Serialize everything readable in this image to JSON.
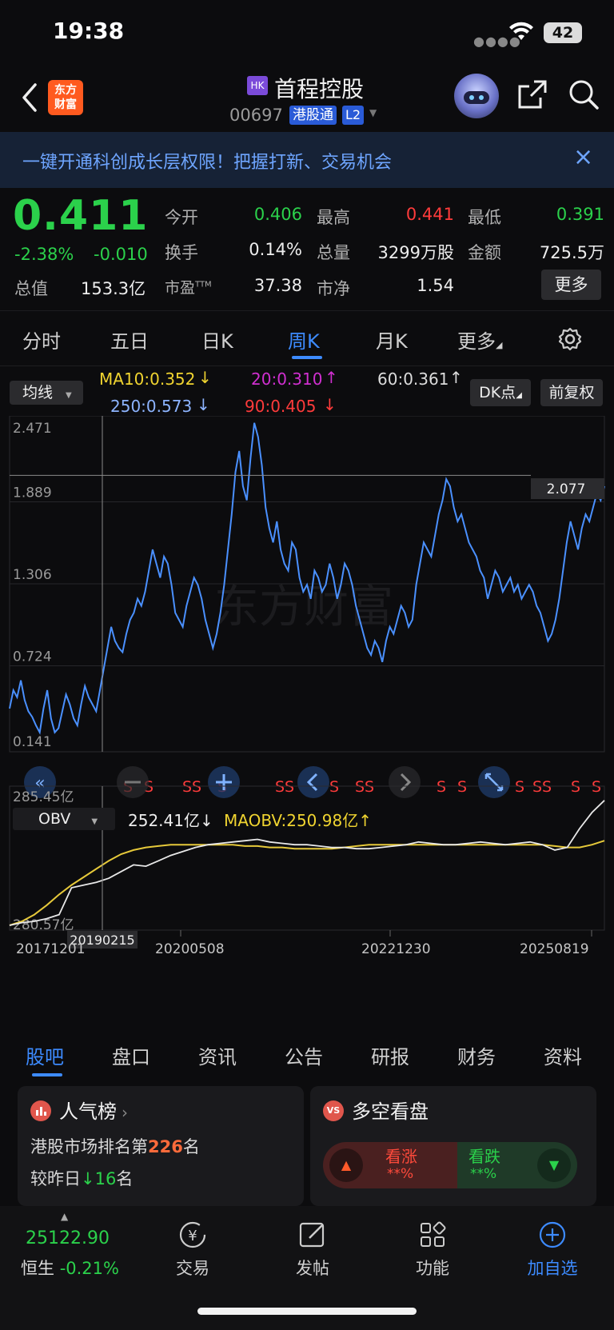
{
  "status_bar": {
    "time": "19:38",
    "battery": "42"
  },
  "header": {
    "app_logo_line1": "东方",
    "app_logo_line2": "财富",
    "market_badge": "HK",
    "stock_name": "首程控股",
    "stock_code": "00697",
    "connect_badge": "港股通",
    "level_badge": "L2"
  },
  "banner": {
    "text": "一键开通科创成长层权限！把握打新、交易机会"
  },
  "quote": {
    "price": "0.411",
    "change_pct": "-2.38%",
    "change_abs": "-0.010",
    "market_cap_label": "总值",
    "market_cap": "153.3亿",
    "fields": {
      "open_label": "今开",
      "open": "0.406",
      "high_label": "最高",
      "high": "0.441",
      "low_label": "最低",
      "low": "0.391",
      "turnover_label": "换手",
      "turnover": "0.14%",
      "volume_label": "总量",
      "volume": "3299万股",
      "amount_label": "金额",
      "amount": "725.5万",
      "pe_label": "市盈",
      "pe_sup": "TTM",
      "pe": "37.38",
      "pb_label": "市净",
      "pb": "1.54"
    },
    "more_label": "更多"
  },
  "period_tabs": [
    "分时",
    "五日",
    "日K",
    "周K",
    "月K",
    "更多"
  ],
  "ma_row": {
    "select_label": "均线",
    "ma10": "MA10:0.352",
    "ma20": "20:0.310",
    "ma60": "60:0.361",
    "ma250": "250:0.573",
    "ma90": "90:0.405",
    "dk_label": "DK点",
    "adjust_label": "前复权"
  },
  "chart_data": {
    "type": "line",
    "y_ticks": [
      "2.471",
      "1.889",
      "1.306",
      "0.724",
      "0.141"
    ],
    "ylim": [
      0.141,
      2.471
    ],
    "crosshair_price": "2.077",
    "watermark": "东方财富",
    "signal_labels": [
      "S",
      "S",
      "SS",
      "S",
      "SS",
      "S",
      "SS",
      "S",
      "S",
      "S",
      "SS",
      "S",
      "S"
    ],
    "x_labels": [
      "20171201",
      "20200508",
      "20221230",
      "20250819"
    ],
    "crosshair_date": "20190215",
    "series": [
      {
        "values": [
          0.42,
          0.55,
          0.5,
          0.62,
          0.48,
          0.4,
          0.36,
          0.3,
          0.25,
          0.42,
          0.55,
          0.35,
          0.25,
          0.28,
          0.4,
          0.52,
          0.45,
          0.35,
          0.3,
          0.45,
          0.58,
          0.5,
          0.45,
          0.4,
          0.55,
          0.7,
          0.85,
          1.0,
          0.9,
          0.85,
          0.82,
          0.95,
          1.05,
          1.1,
          1.2,
          1.15,
          1.25,
          1.4,
          1.55,
          1.45,
          1.35,
          1.5,
          1.45,
          1.3,
          1.1,
          1.05,
          1.0,
          1.15,
          1.25,
          1.35,
          1.3,
          1.2,
          1.05,
          0.95,
          0.85,
          0.95,
          1.1,
          1.3,
          1.55,
          1.8,
          2.1,
          2.25,
          2.0,
          1.9,
          2.2,
          2.45,
          2.35,
          2.15,
          1.85,
          1.7,
          1.6,
          1.75,
          1.55,
          1.45,
          1.4,
          1.6,
          1.55,
          1.35,
          1.25,
          1.3,
          1.2,
          1.4,
          1.35,
          1.25,
          1.3,
          1.45,
          1.35,
          1.2,
          1.3,
          1.45,
          1.4,
          1.3,
          1.15,
          1.05,
          0.95,
          0.85,
          0.8,
          0.9,
          0.85,
          0.75,
          0.9,
          1.0,
          0.95,
          1.05,
          1.15,
          1.1,
          1.0,
          1.05,
          1.3,
          1.45,
          1.6,
          1.55,
          1.5,
          1.65,
          1.8,
          1.9,
          2.05,
          2.0,
          1.85,
          1.75,
          1.8,
          1.7,
          1.6,
          1.55,
          1.5,
          1.4,
          1.35,
          1.2,
          1.3,
          1.4,
          1.35,
          1.25,
          1.3,
          1.35,
          1.25,
          1.3,
          1.2,
          1.25,
          1.3,
          1.25,
          1.15,
          1.1,
          1.0,
          0.9,
          0.95,
          1.05,
          1.2,
          1.4,
          1.6,
          1.75,
          1.65,
          1.55,
          1.7,
          1.8,
          1.75,
          1.85,
          1.95,
          1.9,
          2.0
        ]
      },
      {
        "name": "OBV",
        "value": "252.41亿",
        "ylim": [
          "280.57亿",
          "285.45亿"
        ],
        "values": [
          0.0,
          0.02,
          0.03,
          0.05,
          0.08,
          0.28,
          0.3,
          0.32,
          0.35,
          0.4,
          0.45,
          0.44,
          0.48,
          0.52,
          0.55,
          0.58,
          0.6,
          0.61,
          0.62,
          0.63,
          0.64,
          0.62,
          0.61,
          0.6,
          0.6,
          0.59,
          0.58,
          0.58,
          0.57,
          0.57,
          0.58,
          0.59,
          0.6,
          0.62,
          0.61,
          0.6,
          0.6,
          0.61,
          0.62,
          0.61,
          0.6,
          0.61,
          0.62,
          0.6,
          0.56,
          0.58,
          0.72,
          0.84,
          0.93
        ]
      },
      {
        "name": "MAOBV",
        "value": "250.98亿",
        "values": [
          0.0,
          0.03,
          0.08,
          0.15,
          0.23,
          0.3,
          0.36,
          0.42,
          0.48,
          0.53,
          0.56,
          0.58,
          0.59,
          0.6,
          0.6,
          0.6,
          0.6,
          0.6,
          0.6,
          0.59,
          0.59,
          0.58,
          0.58,
          0.57,
          0.57,
          0.57,
          0.57,
          0.58,
          0.59,
          0.6,
          0.6,
          0.6,
          0.6,
          0.6,
          0.6,
          0.6,
          0.6,
          0.6,
          0.6,
          0.6,
          0.6,
          0.6,
          0.6,
          0.6,
          0.59,
          0.58,
          0.58,
          0.6,
          0.63
        ]
      }
    ]
  },
  "section_tabs": [
    "股吧",
    "盘口",
    "资讯",
    "公告",
    "研报",
    "财务",
    "资料"
  ],
  "cards": {
    "rank_title": "人气榜",
    "rank_prefix": "港股市场排名第",
    "rank_value": "226",
    "rank_suffix": "名",
    "rank_change_prefix": "较昨日",
    "rank_change_value": "16",
    "rank_change_suffix": "名",
    "sentiment_title": "多空看盘",
    "vs_text": "VS",
    "bull_label": "看涨",
    "bull_value": "**%",
    "bear_label": "看跌",
    "bear_value": "**%"
  },
  "bottom_nav": {
    "index_value": "25122.90",
    "index_name": "恒生",
    "index_change": "-0.21%",
    "items": [
      "交易",
      "发帖",
      "功能",
      "加自选"
    ]
  },
  "colors": {
    "up": "#ff3b3b",
    "down": "#2bd14b",
    "accent": "#3d8bff",
    "price_line": "#4a90ff",
    "obv_line": "#e8e8e8",
    "maobv_line": "#e6c93a"
  }
}
